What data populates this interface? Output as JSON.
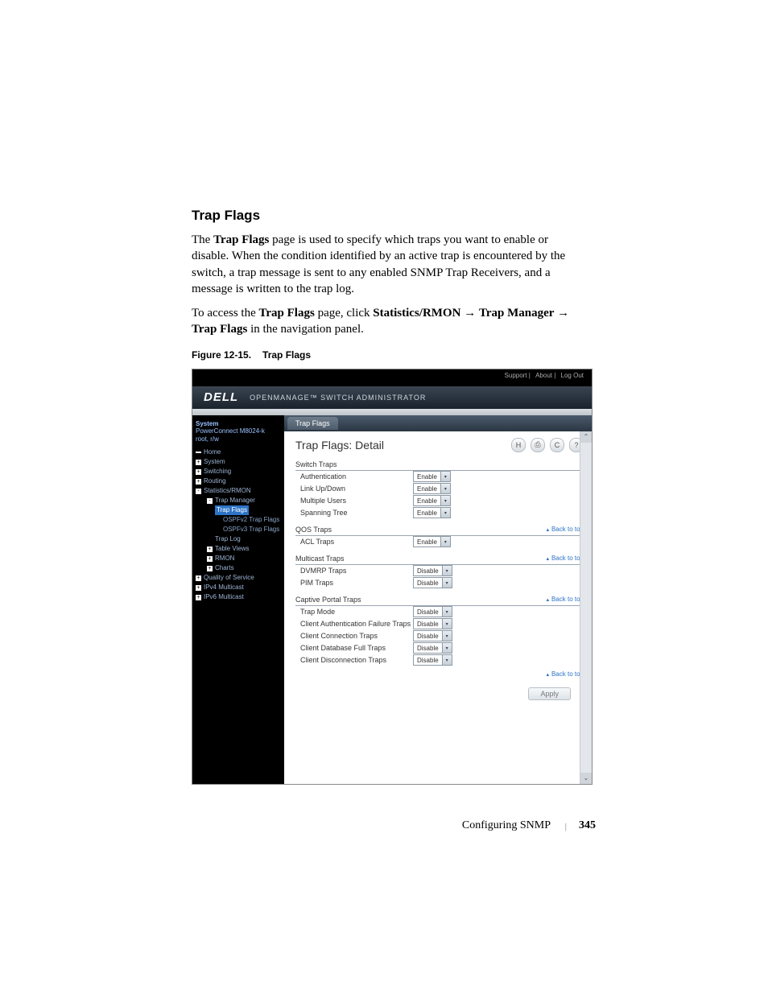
{
  "doc": {
    "section_title": "Trap Flags",
    "para1a": "The ",
    "para1b": "Trap Flags",
    "para1c": " page is used to specify which traps you want to enable or disable. When the condition identified by an active trap is encountered by the switch, a trap message is sent to any enabled SNMP Trap Receivers, and a message is written to the trap log.",
    "para2a": "To access the ",
    "para2b": "Trap Flags",
    "para2c": " page, click ",
    "para2d": "Statistics/RMON",
    "para2e": "Trap Manager",
    "para2f": "Trap Flags",
    "para2g": " in the navigation panel.",
    "fig_label": "Figure 12-15.",
    "fig_title": "Trap Flags",
    "footer_label": "Configuring SNMP",
    "footer_page": "345"
  },
  "shot": {
    "top_links": {
      "support": "Support",
      "about": "About",
      "logout": "Log Out"
    },
    "logo": "DELL",
    "app_name": "OPENMANAGE™ SWITCH ADMINISTRATOR",
    "tree_hdr": {
      "title": "System",
      "device": "PowerConnect M8024-k",
      "user": "root, r/w"
    },
    "tree": [
      {
        "lvl": 1,
        "icon": "bar",
        "label": "Home"
      },
      {
        "lvl": 1,
        "icon": "+",
        "label": "System"
      },
      {
        "lvl": 1,
        "icon": "+",
        "label": "Switching"
      },
      {
        "lvl": 1,
        "icon": "+",
        "label": "Routing"
      },
      {
        "lvl": 1,
        "icon": "-",
        "label": "Statistics/RMON"
      },
      {
        "lvl": 2,
        "icon": "-",
        "label": "Trap Manager"
      },
      {
        "lvl": 3,
        "icon": "",
        "label": "Trap Flags",
        "selected": true
      },
      {
        "lvl": 4,
        "icon": "",
        "label": "OSPFv2 Trap Flags"
      },
      {
        "lvl": 4,
        "icon": "",
        "label": "OSPFv3 Trap Flags"
      },
      {
        "lvl": 3,
        "icon": "",
        "label": "Trap Log"
      },
      {
        "lvl": 2,
        "icon": "+",
        "label": "Table Views"
      },
      {
        "lvl": 2,
        "icon": "+",
        "label": "RMON"
      },
      {
        "lvl": 2,
        "icon": "+",
        "label": "Charts"
      },
      {
        "lvl": 1,
        "icon": "+",
        "label": "Quality of Service"
      },
      {
        "lvl": 1,
        "icon": "+",
        "label": "IPv4 Multicast"
      },
      {
        "lvl": 1,
        "icon": "+",
        "label": "IPv6 Multicast"
      }
    ],
    "tab": "Trap Flags",
    "page_title": "Trap Flags: Detail",
    "back_to_top": "Back to top",
    "apply": "Apply",
    "sections": [
      {
        "title": "Switch Traps",
        "toplink": false,
        "rows": [
          {
            "label": "Authentication",
            "value": "Enable"
          },
          {
            "label": "Link Up/Down",
            "value": "Enable"
          },
          {
            "label": "Multiple Users",
            "value": "Enable"
          },
          {
            "label": "Spanning Tree",
            "value": "Enable"
          }
        ]
      },
      {
        "title": "QOS Traps",
        "toplink": true,
        "rows": [
          {
            "label": "ACL Traps",
            "value": "Enable"
          }
        ]
      },
      {
        "title": "Multicast Traps",
        "toplink": true,
        "rows": [
          {
            "label": "DVMRP Traps",
            "value": "Disable"
          },
          {
            "label": "PIM Traps",
            "value": "Disable"
          }
        ]
      },
      {
        "title": "Captive Portal Traps",
        "toplink": true,
        "rows": [
          {
            "label": "Trap Mode",
            "value": "Disable"
          },
          {
            "label": "Client Authentication Failure Traps",
            "value": "Disable"
          },
          {
            "label": "Client Connection Traps",
            "value": "Disable"
          },
          {
            "label": "Client Database Full Traps",
            "value": "Disable"
          },
          {
            "label": "Client Disconnection Traps",
            "value": "Disable"
          }
        ]
      }
    ]
  }
}
